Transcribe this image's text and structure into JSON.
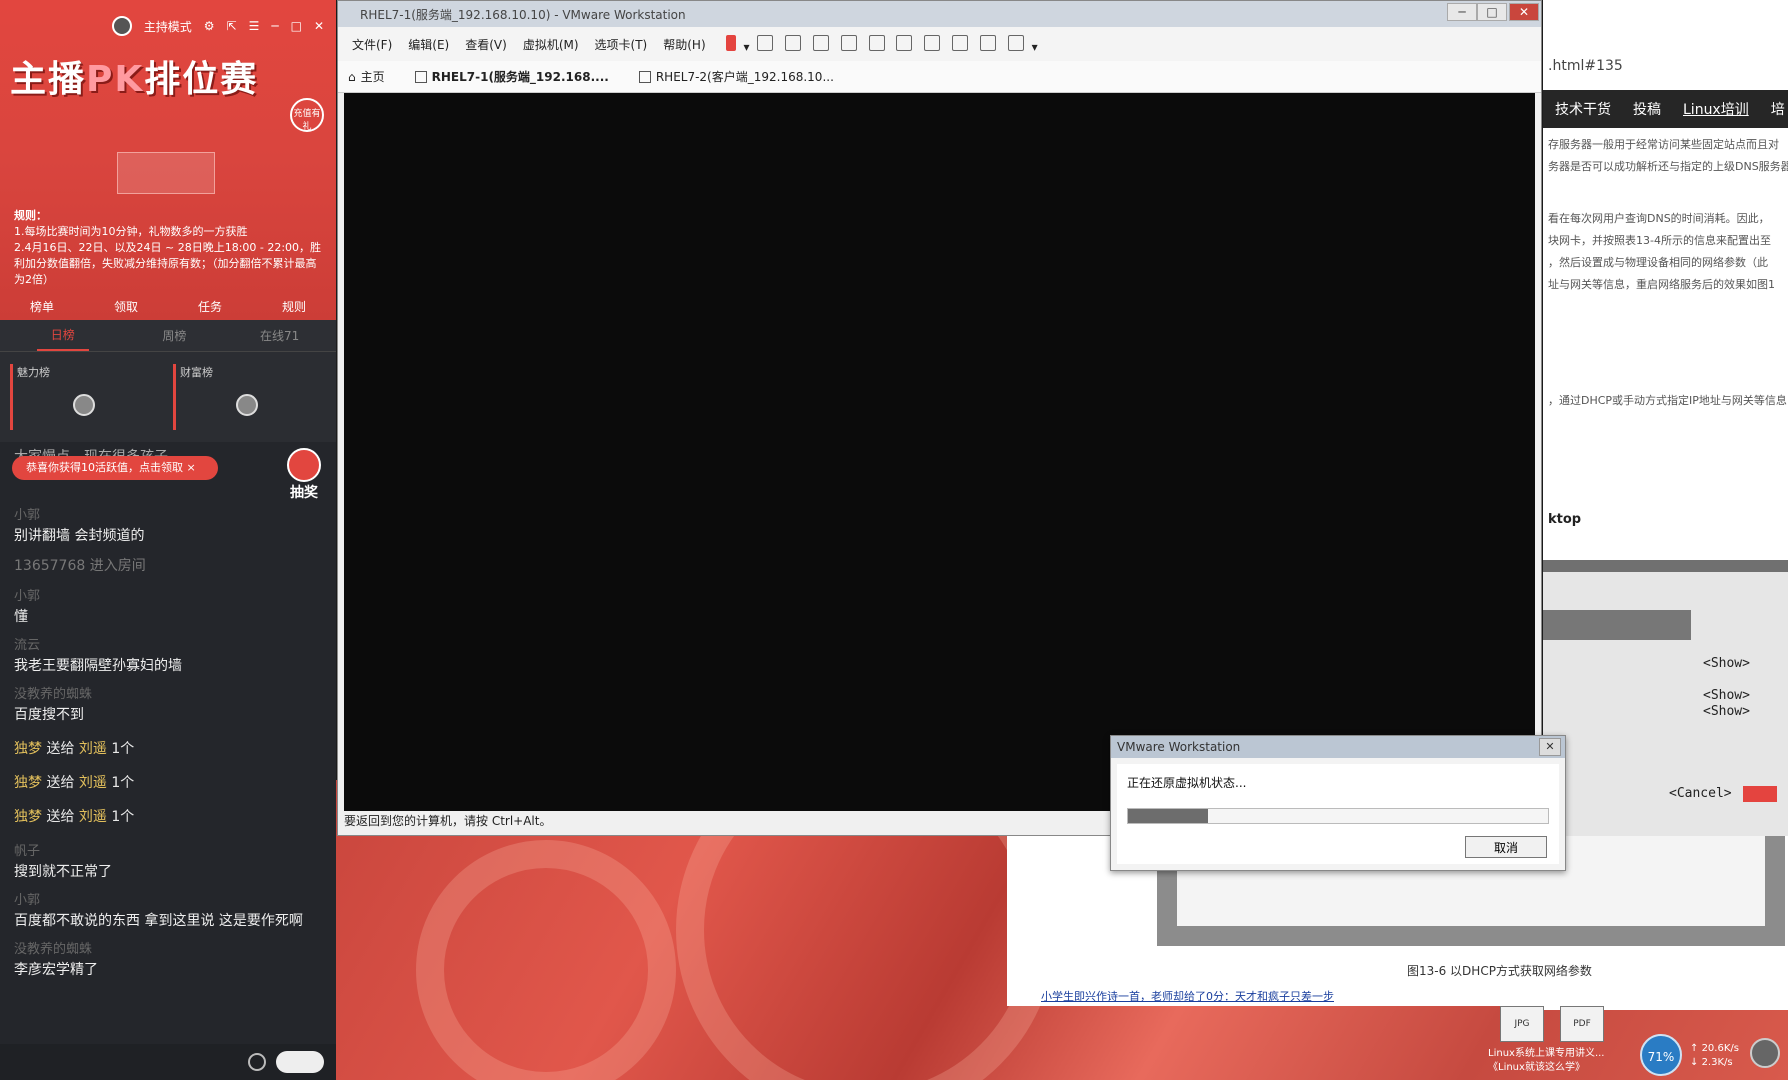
{
  "live": {
    "mode_label": "主持模式",
    "title_main": "主播",
    "title_pk": "PK",
    "title_tail": "排位赛",
    "badge": "充值有礼",
    "rules_heading": "规则：",
    "rules_line1": "1.每场比赛时间为10分钟，礼物数多的一方获胜",
    "rules_line2": "2.4月16日、22日、以及24日 ~ 28日晚上18:00 - 22:00，胜利加分数值翻倍，失败减分维持原有数；（加分翻倍不累计最高为2倍）",
    "nav": [
      "榜单",
      "领取",
      "任务",
      "规则"
    ],
    "tabs": [
      "日榜",
      "周榜",
      "在线71"
    ],
    "ranks": [
      "魅力榜",
      "财富榜"
    ],
    "rank_counts": [
      "1",
      "1"
    ],
    "notice": "恭喜你获得10活跃值，点击领取",
    "lottery": "抽奖",
    "chat_top": "大家慢点，现在很多孩子",
    "messages": [
      {
        "name": "小郭",
        "text": "别讲翻墙 会封频道的"
      },
      {
        "name": "",
        "text": "13657768 进入房间"
      },
      {
        "name": "小郭",
        "text": "懂"
      },
      {
        "name": "流云",
        "text": "我老王要翻隔壁孙寡妇的墙"
      },
      {
        "name": "没教养的蜘蛛",
        "text": "百度搜不到"
      }
    ],
    "gifts": [
      {
        "who": "独梦",
        "verb": "送给",
        "to": "刘遥",
        "n": "1个"
      },
      {
        "who": "独梦",
        "verb": "送给",
        "to": "刘遥",
        "n": "1个"
      },
      {
        "who": "独梦",
        "verb": "送给",
        "to": "刘遥",
        "n": "1个"
      }
    ],
    "messages2": [
      {
        "name": "帆子",
        "text": "搜到就不正常了"
      },
      {
        "name": "小郭",
        "text": "百度都不敢说的东西 拿到这里说 这是要作死啊"
      },
      {
        "name": "没教养的蜘蛛",
        "text": "李彦宏学精了"
      }
    ]
  },
  "vm": {
    "title": "RHEL7-1(服务端_192.168.10.10) - VMware Workstation",
    "menus": [
      "文件(F)",
      "编辑(E)",
      "查看(V)",
      "虚拟机(M)",
      "选项卡(T)",
      "帮助(H)"
    ],
    "home_tab": "主页",
    "tab1": "RHEL7-1(服务端_192.168....",
    "tab2": "RHEL7-2(客户端_192.168.10...",
    "status": "要返回到您的计算机，请按 Ctrl+Alt。"
  },
  "dialog": {
    "title": "VMware Workstation",
    "message": "正在还原虚拟机状态...",
    "progress": 0.19,
    "cancel": "取消"
  },
  "web": {
    "url": ".html#135",
    "nav": [
      "技术干货",
      "投稿",
      "Linux培训",
      "培"
    ],
    "paras": [
      "存服务器一般用于经常访问某些固定站点而且对",
      "务器是否可以成功解析还与指定的上级DNS服务器",
      "看在每次网用户查询DNS的时间消耗。因此，",
      "块网卡，并按照表13-4所示的信息来配置出至",
      "，然后设置成与物理设备相同的网络参数（此",
      "址与网关等信息，重启网络服务后的效果如图1",
      "，通过DHCP或手动方式指定IP地址与网关等信息"
    ],
    "desktop": "ktop",
    "show": [
      "<Show>",
      "<Show>",
      "<Show>"
    ],
    "cancel": "<Cancel>"
  },
  "doc": {
    "caption": "图13-6 以DHCP方式获取网络参数",
    "link": "小学生即兴作诗一首，老师却给了0分：天才和疯子只差一步"
  },
  "tray": {
    "files": [
      {
        "icon": "JPG",
        "label": "Linux系统上课专用讲义..."
      },
      {
        "icon": "PDF",
        "label": "《Linux就该这么学》"
      }
    ],
    "battery": "71%",
    "up": "20.6K/s",
    "down": "2.3K/s"
  }
}
